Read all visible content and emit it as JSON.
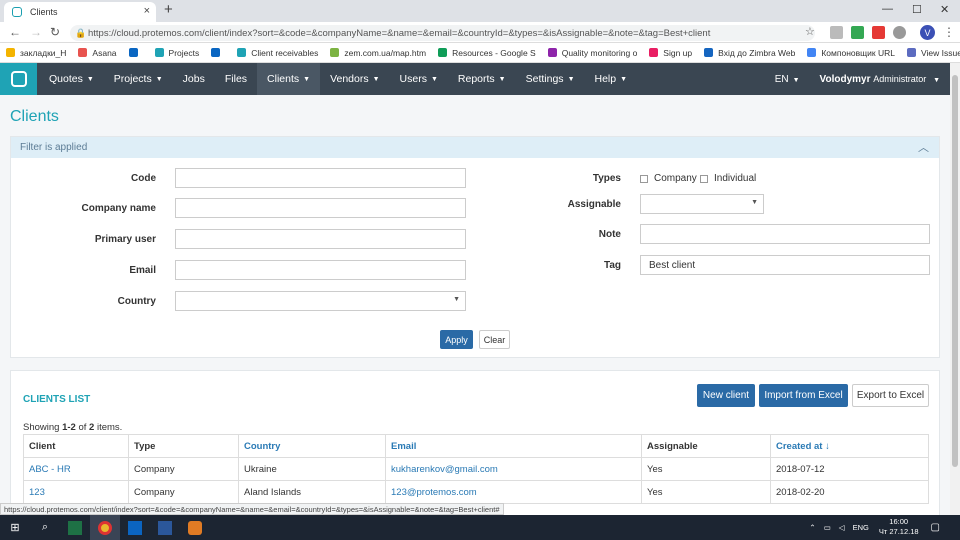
{
  "browser": {
    "tab_title": "Clients",
    "tab_close": "×",
    "new_tab": "+",
    "url": "https://cloud.protemos.com/client/index?sort=&code=&companyName=&name=&email=&countryId=&types=&isAssignable=&note=&tag=Best+client",
    "avatar_letter": "V",
    "status_url": "https://cloud.protemos.com/client/index?sort=&code=&companyName=&name=&email=&countryId=&types=&isAssignable=&note=&tag=Best+client#",
    "bookmarks": [
      {
        "label": "закладки_Н",
        "color": "#f4b400"
      },
      {
        "label": "Asana",
        "color": "#e8534f"
      },
      {
        "label": "",
        "color": "#0a66c2"
      },
      {
        "label": "Projects",
        "color": "#1fa3b5"
      },
      {
        "label": "",
        "color": "#0a66c2"
      },
      {
        "label": "Client receivables",
        "color": "#1fa3b5"
      },
      {
        "label": "zem.com.ua/map.htm",
        "color": "#7cb342"
      },
      {
        "label": "Resources - Google S",
        "color": "#0f9d58"
      },
      {
        "label": "Quality monitoring o",
        "color": "#8e24aa"
      },
      {
        "label": "Sign up",
        "color": "#e91e63"
      },
      {
        "label": "Вхід до Zimbra Web",
        "color": "#1565c0"
      },
      {
        "label": "Компоновщик URL",
        "color": "#4285f4"
      },
      {
        "label": "View Issues - Techno",
        "color": "#5c6bc0"
      }
    ]
  },
  "nav": {
    "items": [
      {
        "label": "Quotes",
        "caret": "▼"
      },
      {
        "label": "Projects",
        "caret": "▼"
      },
      {
        "label": "Jobs",
        "caret": ""
      },
      {
        "label": "Files",
        "caret": ""
      },
      {
        "label": "Clients",
        "caret": "▼"
      },
      {
        "label": "Vendors",
        "caret": "▼"
      },
      {
        "label": "Users",
        "caret": "▼"
      },
      {
        "label": "Reports",
        "caret": "▼"
      },
      {
        "label": "Settings",
        "caret": "▼"
      },
      {
        "label": "Help",
        "caret": "▼"
      }
    ],
    "lang": "EN",
    "user_name": "Volodymyr",
    "user_role": "Administrator"
  },
  "page": {
    "title": "Clients",
    "filter_header": "Filter is applied",
    "filter": {
      "code_label": "Code",
      "company_label": "Company name",
      "primary_user_label": "Primary user",
      "email_label": "Email",
      "country_label": "Country",
      "types_label": "Types",
      "type_company": "Company",
      "type_individual": "Individual",
      "assignable_label": "Assignable",
      "note_label": "Note",
      "tag_label": "Tag",
      "tag_value": "Best client",
      "apply": "Apply",
      "clear": "Clear"
    },
    "list": {
      "title": "CLIENTS LIST",
      "showing_prefix": "Showing ",
      "showing_range": "1-2",
      "showing_of": " of ",
      "showing_total": "2",
      "showing_suffix": " items.",
      "new_client": "New client",
      "import": "Import from Excel",
      "export": "Export to Excel",
      "columns": [
        "Client",
        "Type",
        "Country",
        "Email",
        "Assignable",
        "Created at"
      ],
      "sort_icon": "↓",
      "rows": [
        [
          "ABC - HR",
          "Company",
          "Ukraine",
          "kukharenkov@gmail.com",
          "Yes",
          "2018-07-12"
        ],
        [
          "123",
          "Company",
          "Aland Islands",
          "123@protemos.com",
          "Yes",
          "2018-02-20"
        ]
      ]
    }
  },
  "taskbar": {
    "lang": "ENG",
    "time": "16:00",
    "date": "Чт 27.12.18"
  }
}
